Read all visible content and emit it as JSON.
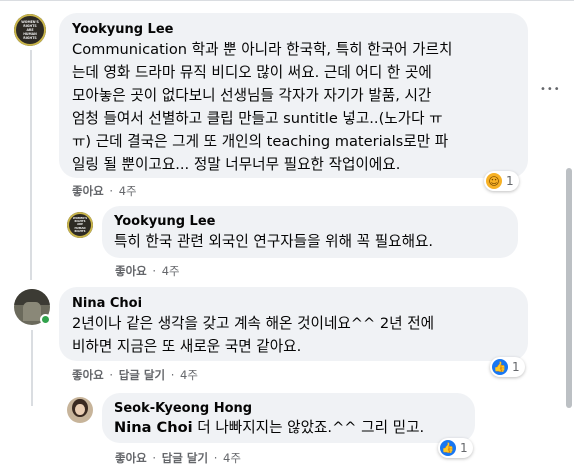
{
  "comments": [
    {
      "author": "Yookyung Lee",
      "avatar_text": [
        "WOMEN'S",
        "RIGHTS",
        "ARE",
        "HUMAN",
        "RIGHTS"
      ],
      "lines": [
        "Communication 학과 뿐 아니라 한국학, 특히 한국어 가르치",
        "는데 영화 드라마 뮤직 비디오 많이 써요. 근데 어디 한 곳에",
        "모아놓은 곳이 없다보니 선생님들 각자가 자기가 발품, 시간",
        "엄청 들여서 선별하고 클립 만들고 suntitle 넣고..(노가다 ㅠ",
        "ㅠ) 근데 결국은 그게 또 개인의 teaching materials로만 파",
        "일링 될 뿐이고요... 정말 너무너무 필요한 작업이에요."
      ],
      "like_label": "좋아요",
      "separator": "·",
      "time": "4주",
      "reaction": {
        "icon": "care-icon",
        "count": "1"
      }
    },
    {
      "author": "Yookyung Lee",
      "avatar_text": [
        "WOMEN'S",
        "RIGHTS",
        "ARE",
        "HUMAN",
        "RIGHTS"
      ],
      "lines": [
        "특히 한국 관련 외국인 연구자들을 위해 꼭 필요해요."
      ],
      "like_label": "좋아요",
      "separator": "·",
      "time": "4주"
    },
    {
      "author": "Nina Choi",
      "lines": [
        "2년이나 같은 생각을 갖고 계속 해온 것이네요^^ 2년 전에",
        "비하면 지금은 또 새로운 국면 같아요."
      ],
      "like_label": "좋아요",
      "reply_label": "답글 달기",
      "separator": "·",
      "time": "4주",
      "reaction": {
        "icon": "like-icon",
        "count": "1"
      }
    },
    {
      "author": "Seok-Kyeong Hong",
      "tag": "Nina Choi",
      "rest": " 더 나빠지지는 않았죠.^^ 그리 믿고.",
      "like_label": "좋아요",
      "reply_label": "답글 달기",
      "separator": "·",
      "time": "4주",
      "reaction": {
        "icon": "like-icon",
        "count": "1"
      }
    }
  ],
  "more_glyph": "•••",
  "colors": {
    "bubble": "#f0f2f5",
    "like_blue": "#1877f2",
    "meta_gray": "#65676b",
    "online_green": "#31a24c"
  }
}
